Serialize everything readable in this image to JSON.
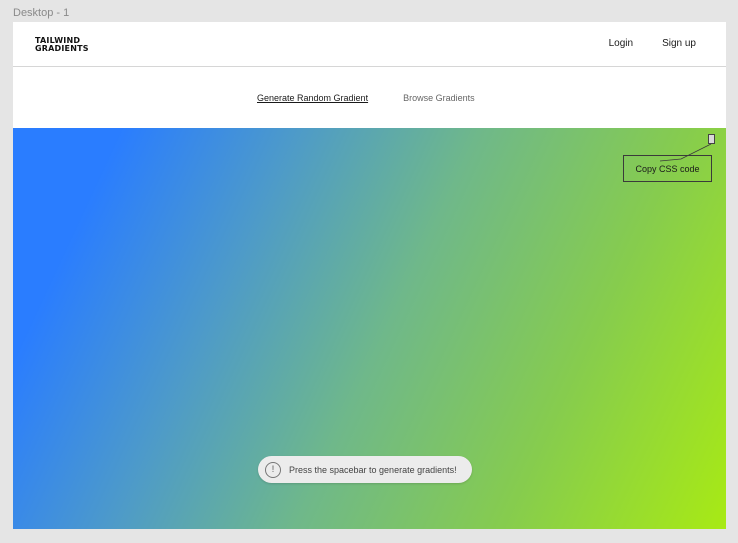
{
  "canvas": {
    "frame_label": "Desktop - 1"
  },
  "navbar": {
    "logo_line1": "TAILWIND",
    "logo_line2": "GRADIENTS",
    "login_label": "Login",
    "signup_label": "Sign up"
  },
  "subnav": {
    "items": [
      {
        "label": "Generate Random Gradient",
        "active": true
      },
      {
        "label": "Browse Gradients",
        "active": false
      }
    ]
  },
  "gradient": {
    "colors": [
      "#2a7dff",
      "#4e9bc8",
      "#6fb88a",
      "#86cc4e",
      "#a8ea14"
    ],
    "copy_button_label": "Copy CSS code"
  },
  "toast": {
    "icon": "info-icon",
    "icon_glyph": "!",
    "message": "Press the spacebar to generate gradients!"
  }
}
